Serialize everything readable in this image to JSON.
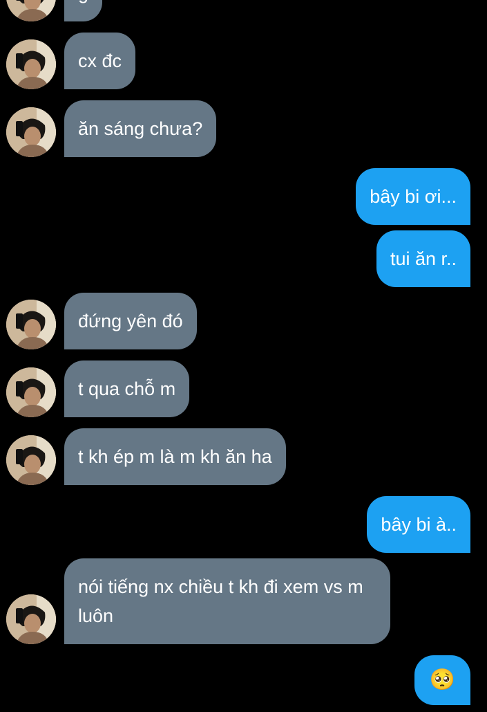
{
  "conversation": {
    "messages": [
      {
        "sender": "them",
        "text": "g"
      },
      {
        "sender": "them",
        "text": "cx đc"
      },
      {
        "sender": "them",
        "text": "ăn sáng chưa?"
      },
      {
        "sender": "me",
        "text": "bây bi ơi..."
      },
      {
        "sender": "me",
        "text": "tui ăn r.."
      },
      {
        "sender": "them",
        "text": "đứng yên đó"
      },
      {
        "sender": "them",
        "text": "t qua chỗ m"
      },
      {
        "sender": "them",
        "text": "t kh ép m là m kh ăn ha"
      },
      {
        "sender": "me",
        "text": "bây bi à.."
      },
      {
        "sender": "them",
        "text": "nói tiếng nx chiều t kh đi xem vs m luôn"
      },
      {
        "sender": "me",
        "text": "🥺"
      }
    ]
  },
  "colors": {
    "background": "#000000",
    "incoming_bubble": "#657786",
    "outgoing_bubble": "#1da1f2",
    "text": "#ffffff"
  },
  "icons": {
    "avatar": "contact-avatar-icon"
  }
}
